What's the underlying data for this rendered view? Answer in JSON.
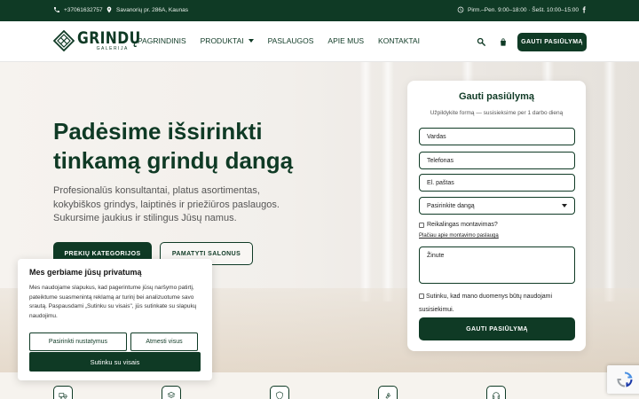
{
  "topbar": {
    "phone": "+37061632757",
    "address": "Savanorių pr. 286A, Kaunas",
    "hours": "Pirm.–Pen. 9:00–18:00 · Šešt. 10:00–15:00"
  },
  "header": {
    "logo_main": "GRINDŲ",
    "logo_sub": "GALERIJA",
    "nav": [
      "PAGRINDINIS",
      "PRODUKTAI",
      "PASLAUGOS",
      "APIE MUS",
      "KONTAKTAI"
    ],
    "cta": "GAUTI PASIŪLYMĄ"
  },
  "hero": {
    "title": "Padėsime išsirinkti tinkamą grindų dangą",
    "description": "Profesionalūs konsultantai, platus asortimentas, kokybiškos grindys, laiptinės ir priežiūros paslaugos. Sukursime jaukius ir stilingus Jūsų namus.",
    "btn_primary": "PREKIŲ KATEGORIJOS",
    "btn_secondary": "PAMATYTI SALONUS"
  },
  "form": {
    "title": "Gauti pasiūlymą",
    "subtitle": "Užpildykite formą — susisieksime per 1 darbo dieną",
    "name_placeholder": "Vardas",
    "phone_placeholder": "Telefonas",
    "email_placeholder": "El. paštas",
    "select_value": "Pasirinkite dangą",
    "install_question": "Reikalingas montavimas?",
    "install_link": "Plačiau apie montavimo paslaugą",
    "message_placeholder": "Žinute",
    "consent": "Sutinku, kad mano duomenys būtų naudojami susisiekimui.",
    "submit": "GAUTI PASIŪLYMĄ"
  },
  "cookie": {
    "title": "Mes gerbiame jūsų privatumą",
    "text": "Mes naudojame slapukus, kad pagerintume jūsų naršymo patirtį, pateiktume suasmenintą reklamą ar turinį bei analizuotume savo srautą. Paspausdami „Sutinku su visais\", jūs sutinkate su slapukų naudojimu.",
    "customize": "Pasirinkti nustatymus",
    "reject": "Atmesti visus",
    "accept": "Sutinku su visais"
  },
  "colors": {
    "brand": "#0f3a25",
    "background": "#f4f2ef"
  },
  "features_icons": [
    "truck-icon",
    "layers-icon",
    "shield-icon",
    "wrench-icon",
    "headset-icon"
  ]
}
